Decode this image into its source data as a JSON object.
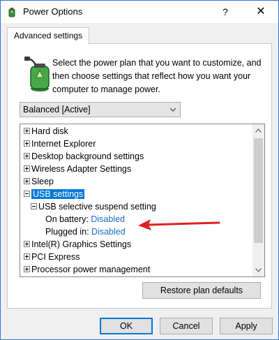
{
  "window": {
    "title": "Power Options",
    "help_label": "?",
    "close_label": "✕"
  },
  "tab": {
    "label": "Advanced settings"
  },
  "description": "Select the power plan that you want to customize, and then choose settings that reflect how you want your computer to manage power.",
  "plan": {
    "selected": "Balanced [Active]"
  },
  "tree": {
    "items": [
      {
        "label": "Hard disk"
      },
      {
        "label": "Internet Explorer"
      },
      {
        "label": "Desktop background settings"
      },
      {
        "label": "Wireless Adapter Settings"
      },
      {
        "label": "Sleep"
      },
      {
        "label": "USB settings"
      },
      {
        "label": "USB selective suspend setting"
      },
      {
        "label": "On battery:",
        "value": "Disabled"
      },
      {
        "label": "Plugged in:",
        "value": "Disabled"
      },
      {
        "label": "Intel(R) Graphics Settings"
      },
      {
        "label": "PCI Express"
      },
      {
        "label": "Processor power management"
      }
    ]
  },
  "buttons": {
    "restore": "Restore plan defaults",
    "ok": "OK",
    "cancel": "Cancel",
    "apply": "Apply"
  },
  "colors": {
    "selection": "#0078d7",
    "link": "#1a6fc9",
    "annotation_arrow": "#e02020"
  }
}
